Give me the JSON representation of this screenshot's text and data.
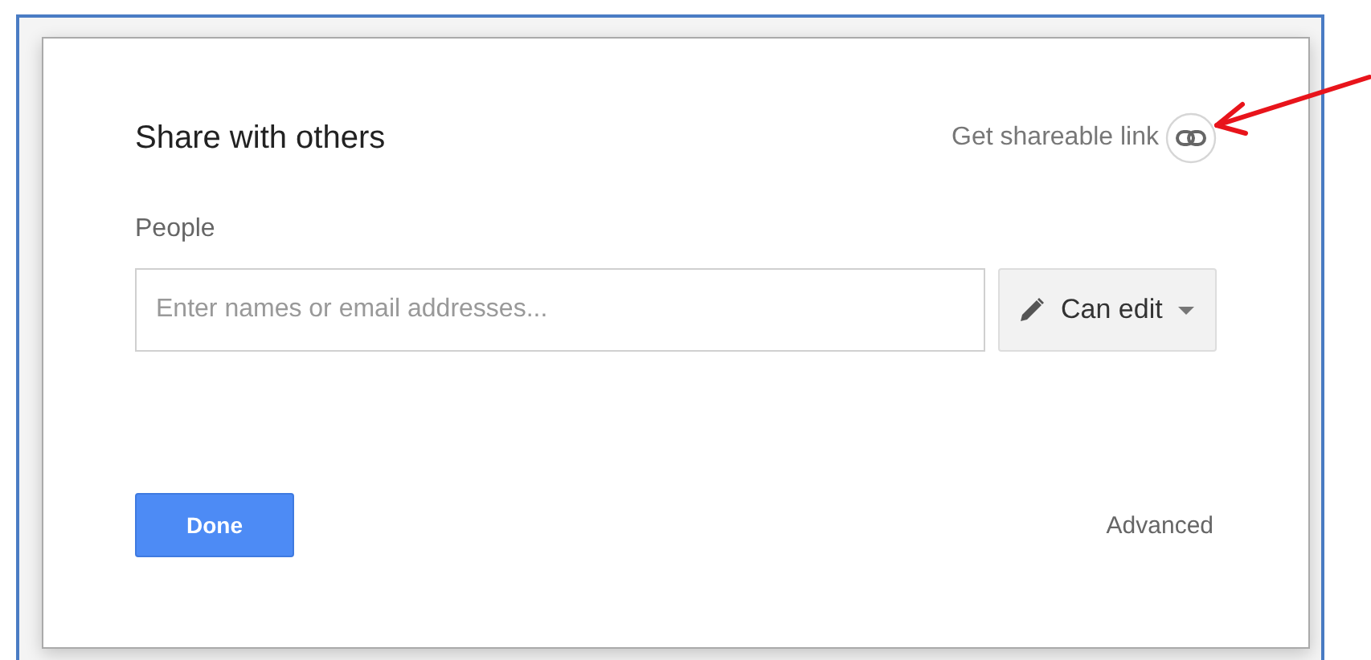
{
  "dialog": {
    "title": "Share with others",
    "link_action": "Get shareable link",
    "people_label": "People",
    "people_field": {
      "placeholder": "Enter names or email addresses..."
    },
    "permission": {
      "label": "Can edit"
    },
    "done_button": "Done",
    "advanced_link": "Advanced"
  }
}
